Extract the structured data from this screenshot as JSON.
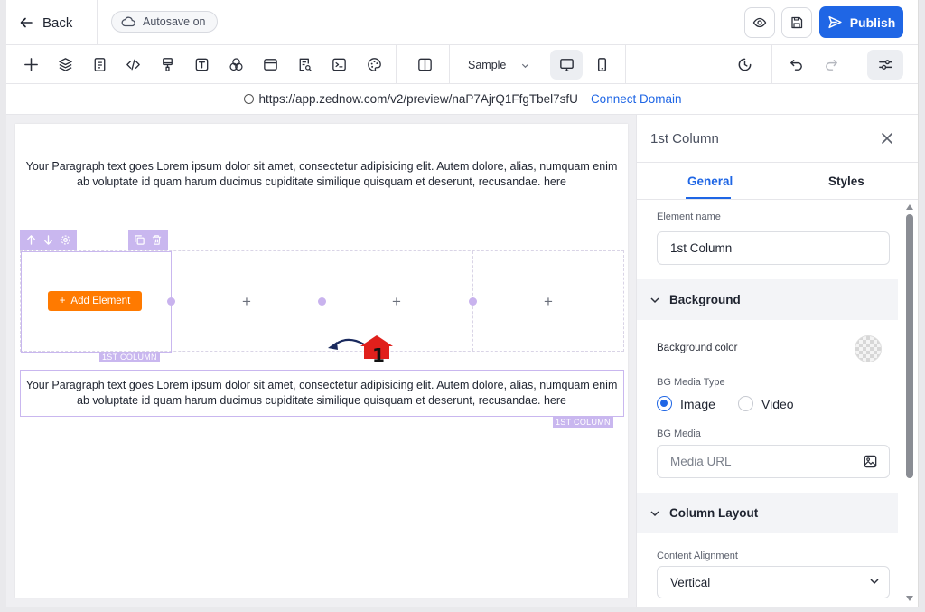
{
  "topbar": {
    "back_label": "Back",
    "autosave_label": "Autosave on",
    "publish_label": "Publish"
  },
  "toolbar": {
    "sample_label": "Sample"
  },
  "urlbar": {
    "url": "https://app.zednow.com/v2/preview/naP7AjrQ1FfgTbel7sfU",
    "connect_label": "Connect Domain"
  },
  "canvas": {
    "paragraph_1": "Your Paragraph text goes Lorem ipsum dolor sit amet, consectetur adipisicing elit. Autem dolore, alias, numquam enim ab voluptate id quam harum ducimus cupiditate similique quisquam et deserunt, recusandae. here",
    "paragraph_2": "Your Paragraph text goes Lorem ipsum dolor sit amet, consectetur adipisicing elit. Autem dolore, alias, numquam enim ab voluptate id quam harum ducimus cupiditate similique quisquam et deserunt, recusandae. here",
    "add_element_label": "Add Element",
    "column_label_1": "1ST COLUMN",
    "column_label_2": "1ST COLUMN",
    "plus_symbol": "+",
    "annotation_number": "1"
  },
  "panel": {
    "title": "1st Column",
    "tabs": [
      {
        "label": "General",
        "active": true
      },
      {
        "label": "Styles",
        "active": false
      }
    ],
    "element_name_label": "Element name",
    "element_name_value": "1st Column",
    "background_section": "Background",
    "background_color_label": "Background color",
    "bg_media_type_label": "BG Media Type",
    "media_type_options": [
      "Image",
      "Video"
    ],
    "media_type_selected": "Image",
    "bg_media_label": "BG Media",
    "media_url_placeholder": "Media URL",
    "column_layout_section": "Column Layout",
    "content_alignment_label": "Content Alignment",
    "content_alignment_value": "Vertical"
  },
  "colors": {
    "accent": "#1f66e5",
    "add_element": "#ff7a00",
    "column_highlight": "#c9b7ef",
    "annotation": "#e0201c"
  }
}
